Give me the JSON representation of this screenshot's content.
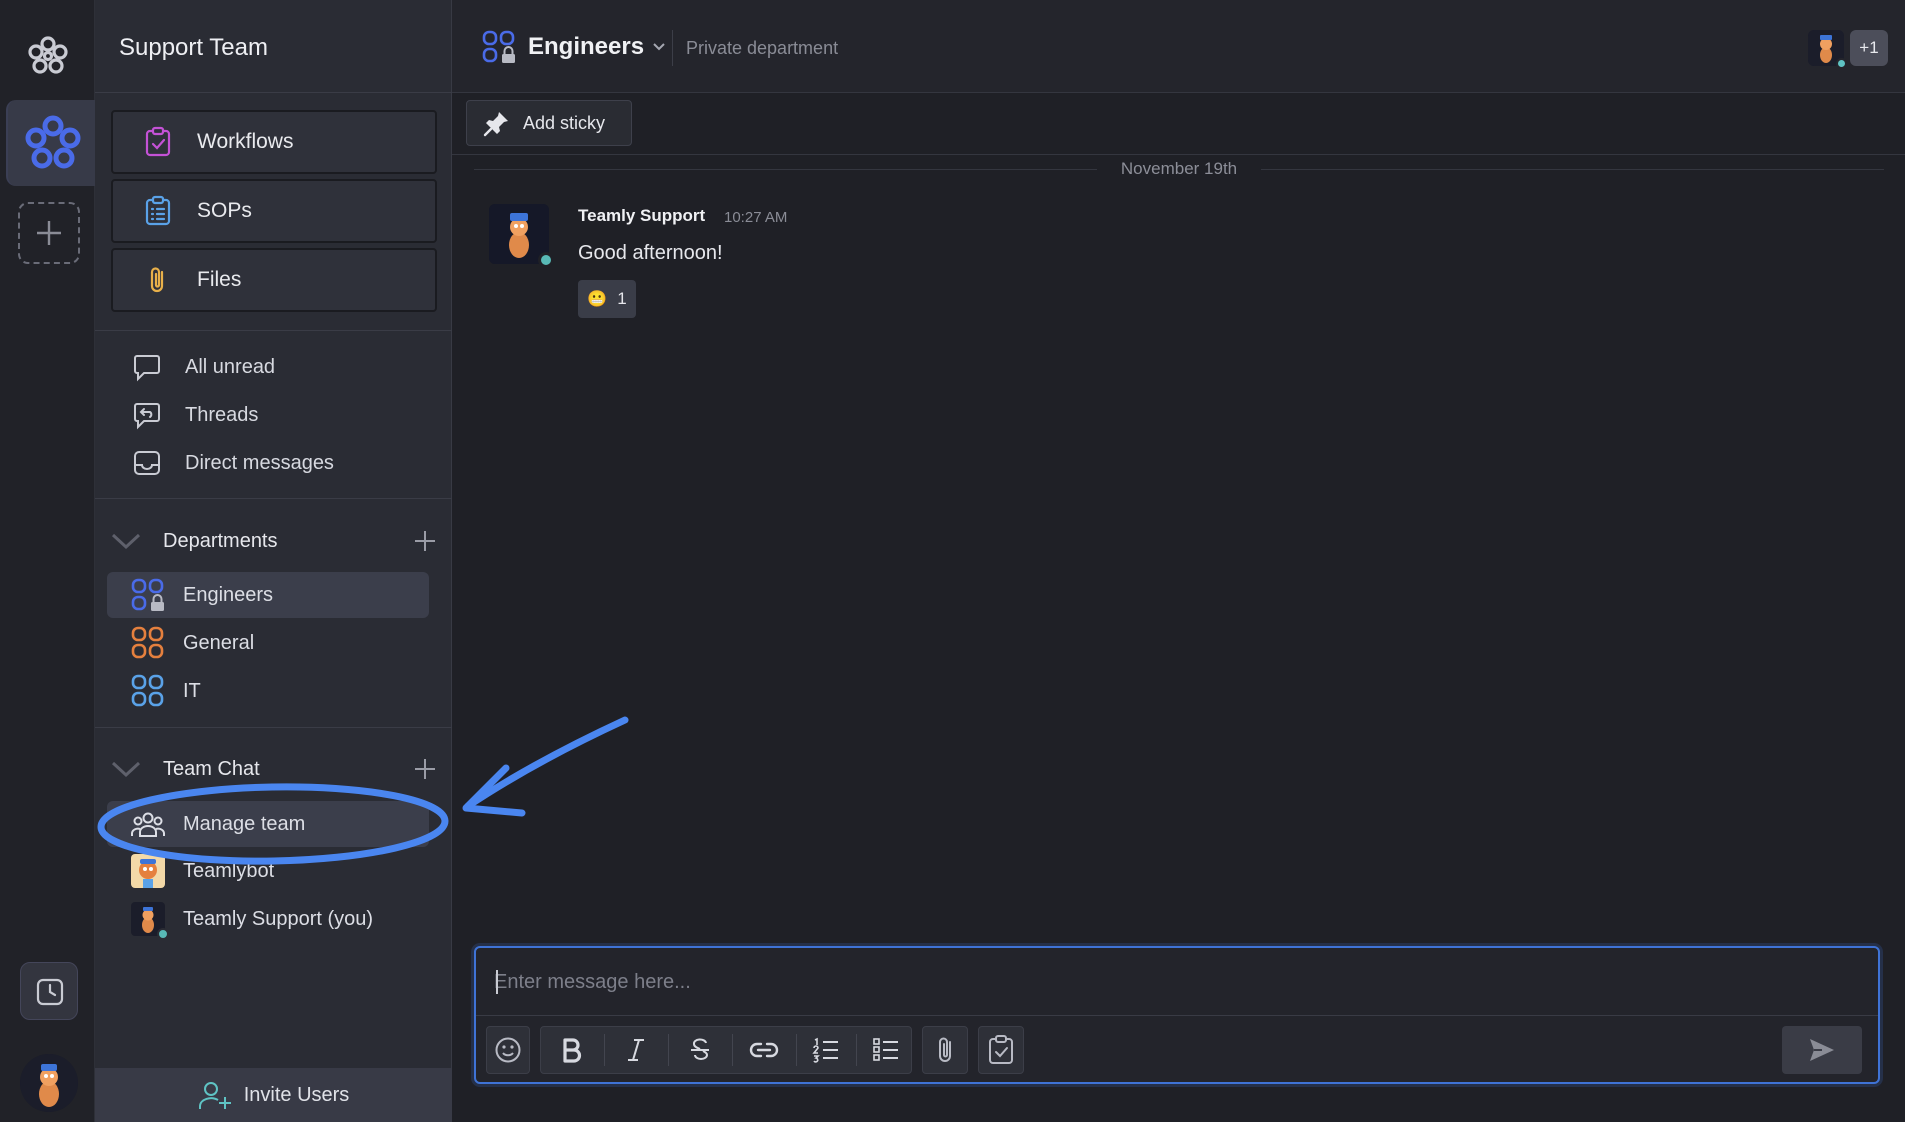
{
  "workspace": {
    "name": "Support Team"
  },
  "sidebar": {
    "tools": [
      {
        "label": "Workflows",
        "icon": "clipboard-check-icon"
      },
      {
        "label": "SOPs",
        "icon": "clipboard-list-icon"
      },
      {
        "label": "Files",
        "icon": "paperclip-icon"
      }
    ],
    "nav": [
      {
        "label": "All unread",
        "icon": "speech-bubble-icon"
      },
      {
        "label": "Threads",
        "icon": "reply-bubble-icon"
      },
      {
        "label": "Direct messages",
        "icon": "inbox-icon"
      }
    ],
    "departments": {
      "title": "Departments",
      "items": [
        {
          "label": "Engineers",
          "color": "#4a6be8",
          "locked": true,
          "active": true
        },
        {
          "label": "General",
          "color": "#e5803e",
          "locked": false,
          "active": false
        },
        {
          "label": "IT",
          "color": "#5aa2e8",
          "locked": false,
          "active": false
        }
      ]
    },
    "team_chat": {
      "title": "Team Chat",
      "items": [
        {
          "label": "Manage team",
          "icon": "users-icon"
        },
        {
          "label": "Teamlybot",
          "icon": "bot-avatar"
        },
        {
          "label": "Teamly Support (you)",
          "icon": "user-avatar"
        }
      ]
    },
    "invite_label": "Invite Users"
  },
  "channel": {
    "name": "Engineers",
    "description": "Private department",
    "members_extra": "+1"
  },
  "sticky": {
    "add_label": "Add sticky"
  },
  "messages": {
    "date": "November 19th",
    "items": [
      {
        "author": "Teamly Support",
        "time": "10:27 AM",
        "text": "Good afternoon!",
        "reaction": {
          "emoji": "😬",
          "count": "1"
        }
      }
    ]
  },
  "composer": {
    "placeholder": "Enter message here...",
    "tools": [
      "emoji-icon",
      "bold-icon",
      "italic-icon",
      "strikethrough-icon",
      "link-icon",
      "numbered-list-icon",
      "bullet-list-icon",
      "attach-icon",
      "task-icon",
      "send-icon"
    ]
  },
  "colors": {
    "accent": "#3f73d6",
    "annotation": "#4a86f0",
    "online": "#58b9b6"
  }
}
